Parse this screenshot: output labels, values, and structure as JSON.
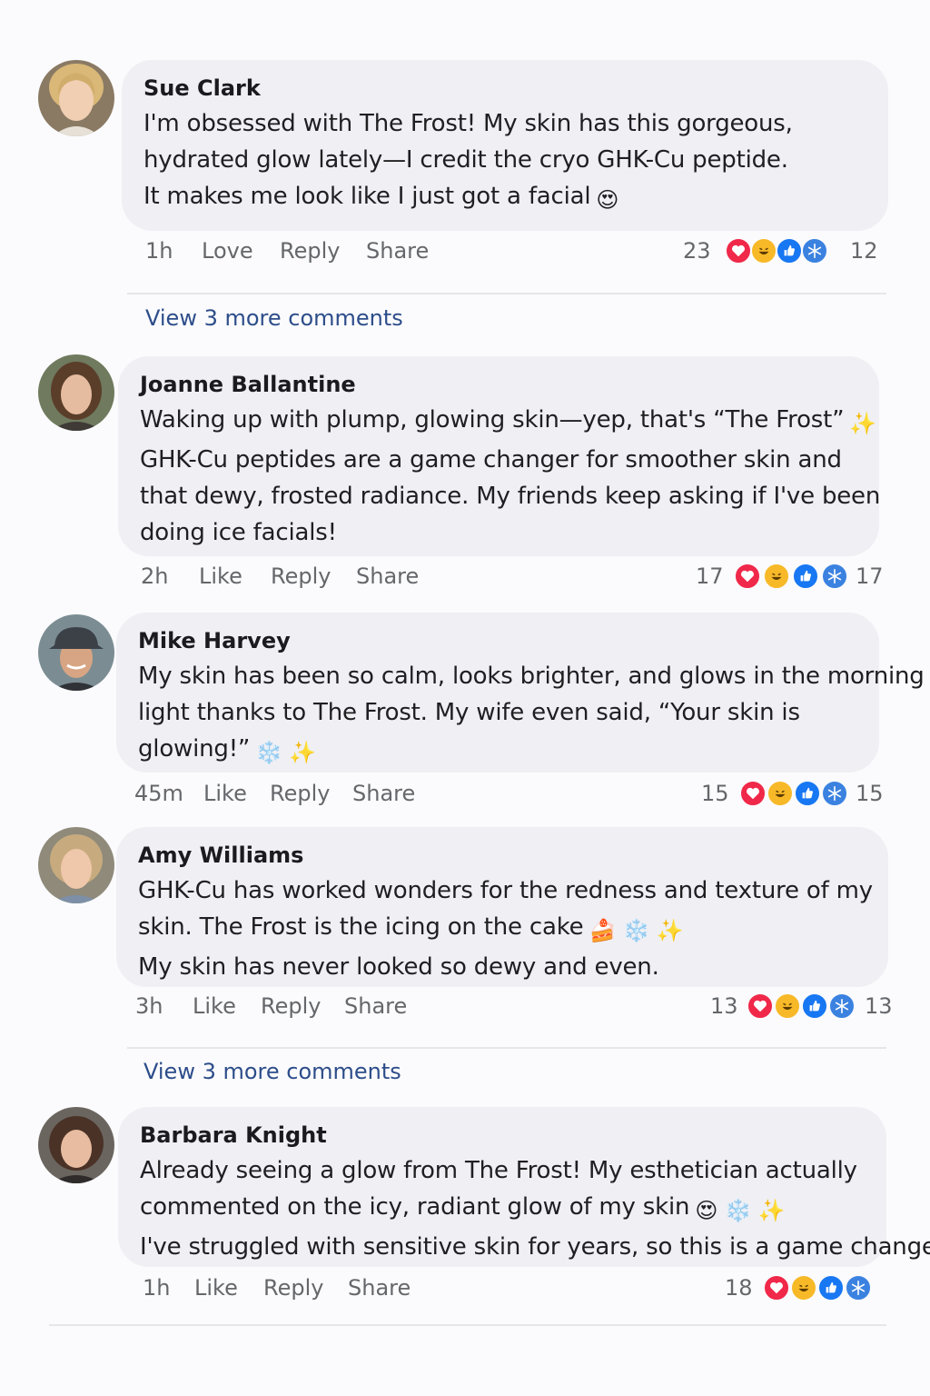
{
  "comments": [
    {
      "author": "Sue Clark",
      "lines": [
        "I'm obsessed with The Frost! My skin has this gorgeous,",
        "hydrated glow lately—I credit the cryo GHK-Cu peptide.",
        "It makes me look like I just got a facial"
      ],
      "emoji": [
        "😍",
        "",
        ""
      ],
      "time": "1h",
      "action1": "Love",
      "reply": "Reply",
      "share": "Share",
      "count_left": "23",
      "count_right": "12"
    },
    {
      "author": "Joanne Ballantine",
      "lines": [
        "Waking up with plump, glowing skin—yep, that's “The Frost”",
        "GHK-Cu peptides are a game changer for smoother skin and",
        "that dewy, frosted radiance. My friends keep asking if I've been",
        "doing ice facials!"
      ],
      "emoji": [
        "✨",
        "",
        "",
        ""
      ],
      "time": "2h",
      "action1": "Like",
      "reply": "Reply",
      "share": "Share",
      "count_left": "17",
      "count_right": "17"
    },
    {
      "author": "Mike Harvey",
      "lines": [
        "My skin has been so calm, looks brighter, and glows in the morning",
        "light thanks to The Frost. My wife even said, “Your skin is",
        "glowing!”"
      ],
      "emoji": [
        "",
        "",
        "❄️ ✨"
      ],
      "time": "45m",
      "action1": "Like",
      "reply": "Reply",
      "share": "Share",
      "count_left": "15",
      "count_right": "15"
    },
    {
      "author": "Amy Williams",
      "lines": [
        "GHK-Cu has worked wonders for the redness and texture of my",
        "skin. The Frost is the icing on the cake",
        "My skin has never looked so dewy and even."
      ],
      "emoji": [
        "",
        "🍰 ❄️ ✨",
        ""
      ],
      "time": "3h",
      "action1": "Like",
      "reply": "Reply",
      "share": "Share",
      "count_left": "13",
      "count_right": "13"
    },
    {
      "author": "Barbara Knight",
      "lines": [
        "Already seeing a glow from The Frost! My esthetician actually",
        "commented on the icy, radiant glow of my skin",
        "I've struggled with sensitive skin for years, so this is a game changer."
      ],
      "emoji": [
        "",
        "😍 ❄️ ✨",
        ""
      ],
      "time": "1h",
      "action1": "Like",
      "reply": "Reply",
      "share": "Share",
      "count_left": "18",
      "count_right": ""
    }
  ],
  "view_more": [
    "View 3 more comments",
    "View 3 more comments"
  ],
  "reaction_icons": [
    "love-icon",
    "haha-icon",
    "like-icon",
    "snowflake-icon"
  ],
  "colors": {
    "love": "#f02849",
    "haha": "#f7b928",
    "like": "#1877f2",
    "snow": "#3b82e0",
    "link": "#2d4d8a"
  }
}
